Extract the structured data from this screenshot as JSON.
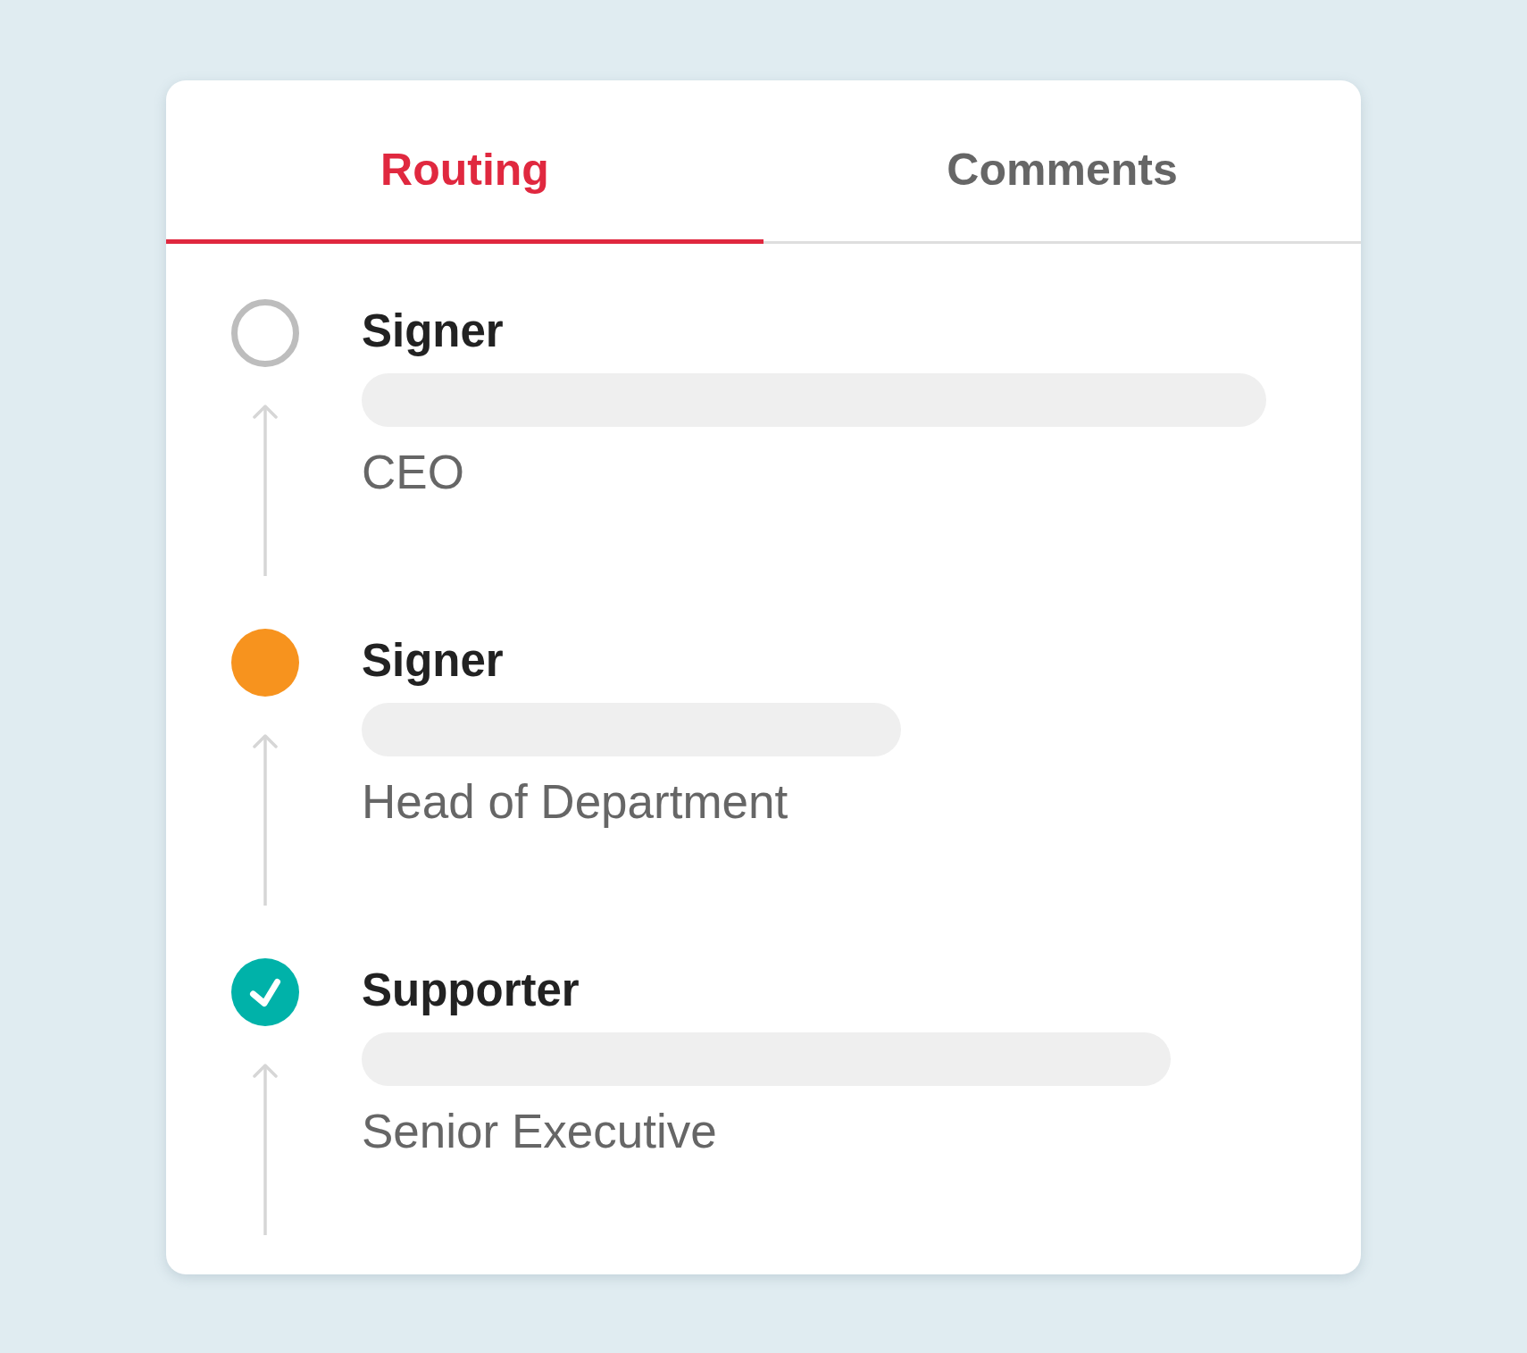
{
  "tabs": [
    {
      "label": "Routing",
      "selected": true
    },
    {
      "label": "Comments",
      "selected": false
    }
  ],
  "steps": [
    {
      "kind": "pending",
      "role": "Signer",
      "position": "CEO"
    },
    {
      "kind": "current",
      "role": "Signer",
      "position": "Head of Department"
    },
    {
      "kind": "done",
      "role": "Supporter",
      "position": "Senior Executive"
    }
  ]
}
